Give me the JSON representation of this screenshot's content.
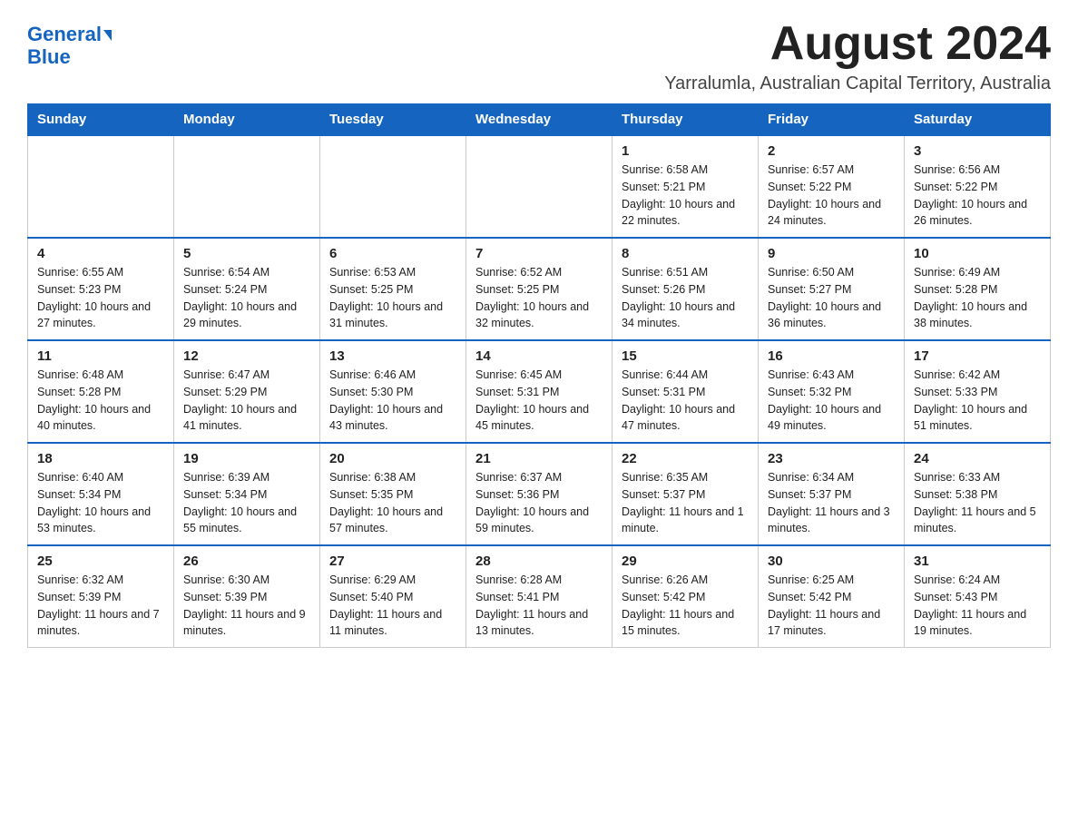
{
  "header": {
    "logo_general": "General",
    "logo_blue": "Blue",
    "month_title": "August 2024",
    "location": "Yarralumla, Australian Capital Territory, Australia"
  },
  "days_of_week": [
    "Sunday",
    "Monday",
    "Tuesday",
    "Wednesday",
    "Thursday",
    "Friday",
    "Saturday"
  ],
  "weeks": [
    [
      {
        "num": "",
        "info": ""
      },
      {
        "num": "",
        "info": ""
      },
      {
        "num": "",
        "info": ""
      },
      {
        "num": "",
        "info": ""
      },
      {
        "num": "1",
        "info": "Sunrise: 6:58 AM\nSunset: 5:21 PM\nDaylight: 10 hours and 22 minutes."
      },
      {
        "num": "2",
        "info": "Sunrise: 6:57 AM\nSunset: 5:22 PM\nDaylight: 10 hours and 24 minutes."
      },
      {
        "num": "3",
        "info": "Sunrise: 6:56 AM\nSunset: 5:22 PM\nDaylight: 10 hours and 26 minutes."
      }
    ],
    [
      {
        "num": "4",
        "info": "Sunrise: 6:55 AM\nSunset: 5:23 PM\nDaylight: 10 hours and 27 minutes."
      },
      {
        "num": "5",
        "info": "Sunrise: 6:54 AM\nSunset: 5:24 PM\nDaylight: 10 hours and 29 minutes."
      },
      {
        "num": "6",
        "info": "Sunrise: 6:53 AM\nSunset: 5:25 PM\nDaylight: 10 hours and 31 minutes."
      },
      {
        "num": "7",
        "info": "Sunrise: 6:52 AM\nSunset: 5:25 PM\nDaylight: 10 hours and 32 minutes."
      },
      {
        "num": "8",
        "info": "Sunrise: 6:51 AM\nSunset: 5:26 PM\nDaylight: 10 hours and 34 minutes."
      },
      {
        "num": "9",
        "info": "Sunrise: 6:50 AM\nSunset: 5:27 PM\nDaylight: 10 hours and 36 minutes."
      },
      {
        "num": "10",
        "info": "Sunrise: 6:49 AM\nSunset: 5:28 PM\nDaylight: 10 hours and 38 minutes."
      }
    ],
    [
      {
        "num": "11",
        "info": "Sunrise: 6:48 AM\nSunset: 5:28 PM\nDaylight: 10 hours and 40 minutes."
      },
      {
        "num": "12",
        "info": "Sunrise: 6:47 AM\nSunset: 5:29 PM\nDaylight: 10 hours and 41 minutes."
      },
      {
        "num": "13",
        "info": "Sunrise: 6:46 AM\nSunset: 5:30 PM\nDaylight: 10 hours and 43 minutes."
      },
      {
        "num": "14",
        "info": "Sunrise: 6:45 AM\nSunset: 5:31 PM\nDaylight: 10 hours and 45 minutes."
      },
      {
        "num": "15",
        "info": "Sunrise: 6:44 AM\nSunset: 5:31 PM\nDaylight: 10 hours and 47 minutes."
      },
      {
        "num": "16",
        "info": "Sunrise: 6:43 AM\nSunset: 5:32 PM\nDaylight: 10 hours and 49 minutes."
      },
      {
        "num": "17",
        "info": "Sunrise: 6:42 AM\nSunset: 5:33 PM\nDaylight: 10 hours and 51 minutes."
      }
    ],
    [
      {
        "num": "18",
        "info": "Sunrise: 6:40 AM\nSunset: 5:34 PM\nDaylight: 10 hours and 53 minutes."
      },
      {
        "num": "19",
        "info": "Sunrise: 6:39 AM\nSunset: 5:34 PM\nDaylight: 10 hours and 55 minutes."
      },
      {
        "num": "20",
        "info": "Sunrise: 6:38 AM\nSunset: 5:35 PM\nDaylight: 10 hours and 57 minutes."
      },
      {
        "num": "21",
        "info": "Sunrise: 6:37 AM\nSunset: 5:36 PM\nDaylight: 10 hours and 59 minutes."
      },
      {
        "num": "22",
        "info": "Sunrise: 6:35 AM\nSunset: 5:37 PM\nDaylight: 11 hours and 1 minute."
      },
      {
        "num": "23",
        "info": "Sunrise: 6:34 AM\nSunset: 5:37 PM\nDaylight: 11 hours and 3 minutes."
      },
      {
        "num": "24",
        "info": "Sunrise: 6:33 AM\nSunset: 5:38 PM\nDaylight: 11 hours and 5 minutes."
      }
    ],
    [
      {
        "num": "25",
        "info": "Sunrise: 6:32 AM\nSunset: 5:39 PM\nDaylight: 11 hours and 7 minutes."
      },
      {
        "num": "26",
        "info": "Sunrise: 6:30 AM\nSunset: 5:39 PM\nDaylight: 11 hours and 9 minutes."
      },
      {
        "num": "27",
        "info": "Sunrise: 6:29 AM\nSunset: 5:40 PM\nDaylight: 11 hours and 11 minutes."
      },
      {
        "num": "28",
        "info": "Sunrise: 6:28 AM\nSunset: 5:41 PM\nDaylight: 11 hours and 13 minutes."
      },
      {
        "num": "29",
        "info": "Sunrise: 6:26 AM\nSunset: 5:42 PM\nDaylight: 11 hours and 15 minutes."
      },
      {
        "num": "30",
        "info": "Sunrise: 6:25 AM\nSunset: 5:42 PM\nDaylight: 11 hours and 17 minutes."
      },
      {
        "num": "31",
        "info": "Sunrise: 6:24 AM\nSunset: 5:43 PM\nDaylight: 11 hours and 19 minutes."
      }
    ]
  ]
}
